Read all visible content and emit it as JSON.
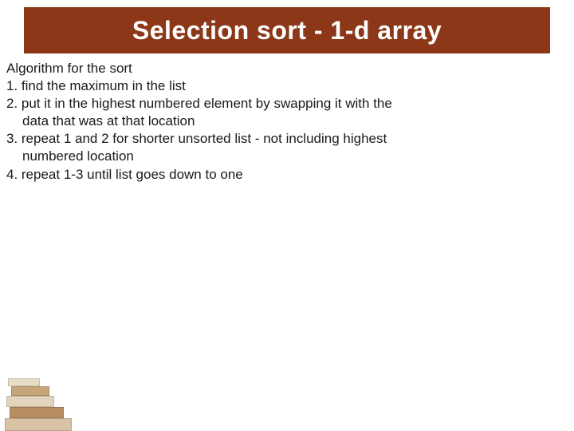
{
  "title": "Selection sort - 1-d array",
  "body": {
    "heading": "Algorithm for the sort",
    "step1": "1.  find the maximum in the list",
    "step2a": "2.  put it in the highest numbered element by swapping it with the",
    "step2b": "data that was at that location",
    "step3a": "3. repeat 1 and 2 for shorter unsorted list - not including highest",
    "step3b": "numbered location",
    "step4": "4.  repeat 1-3 until list goes down to one"
  }
}
